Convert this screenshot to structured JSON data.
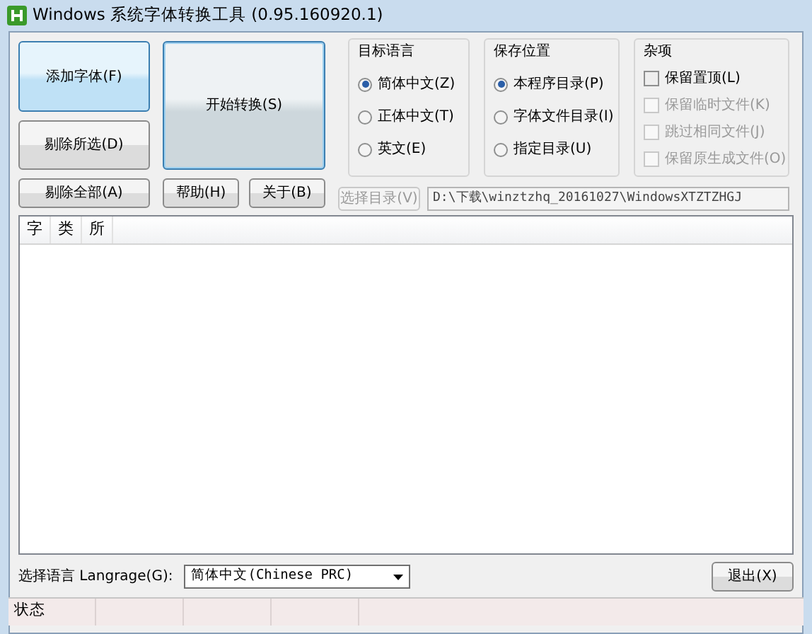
{
  "window": {
    "title": "Windows 系统字体转换工具 (0.95.160920.1)"
  },
  "buttons": {
    "add_font": "添加字体(F)",
    "remove_selected": "剔除所选(D)",
    "remove_all": "剔除全部(A)",
    "start": "开始转换(S)",
    "help": "帮助(H)",
    "about": "关于(B)"
  },
  "groups": [
    {
      "title": "目标语言",
      "kind": "radio",
      "items": [
        {
          "label": "简体中文(Z)",
          "selected": true,
          "disabled": false
        },
        {
          "label": "正体中文(T)",
          "selected": false,
          "disabled": false
        },
        {
          "label": "英文(E)",
          "selected": false,
          "disabled": false
        }
      ]
    },
    {
      "title": "保存位置",
      "kind": "radio",
      "items": [
        {
          "label": "本程序目录(P)",
          "selected": true,
          "disabled": false
        },
        {
          "label": "字体文件目录(I)",
          "selected": false,
          "disabled": false
        },
        {
          "label": "指定目录(U)",
          "selected": false,
          "disabled": false
        }
      ]
    },
    {
      "title": "杂项",
      "kind": "check",
      "items": [
        {
          "label": "保留置顶(L)",
          "checked": false,
          "disabled": false
        },
        {
          "label": "保留临时文件(K)",
          "checked": false,
          "disabled": true
        },
        {
          "label": "跳过相同文件(J)",
          "checked": false,
          "disabled": true
        },
        {
          "label": "保留原生成文件(O)",
          "checked": false,
          "disabled": true
        }
      ]
    }
  ],
  "directory": {
    "button": "选择目录(V)",
    "button_disabled": true,
    "value": "D:\\下载\\winztzhq_20161027\\WindowsXTZTZHGJ"
  },
  "file_list": {
    "columns": [
      "字",
      "类",
      "所"
    ]
  },
  "language": {
    "label": "选择语言 Langrage(G):",
    "value": "简体中文(Chinese PRC)"
  },
  "exit_button": "退出(X)",
  "status_bar": "状态"
}
